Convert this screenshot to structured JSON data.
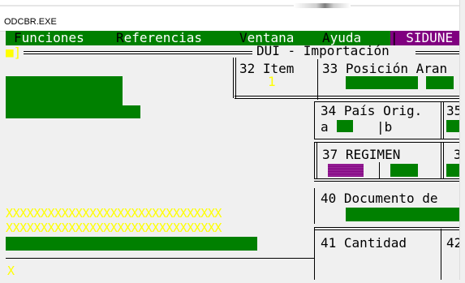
{
  "window": {
    "title": "ODCBR.EXE"
  },
  "menu": {
    "items": [
      {
        "hotkey": "F",
        "rest": "unciones"
      },
      {
        "hotkey": "R",
        "rest": "eferencias"
      },
      {
        "hotkey": "V",
        "rest": "entana"
      },
      {
        "hotkey": "A",
        "rest": "yuda"
      }
    ],
    "app_label": "SIDUNE"
  },
  "form": {
    "corner_marker": "■]",
    "title": "DUI - Importación",
    "fields": {
      "item_label": "32 Item",
      "item_value": "1",
      "posicion_label": "33 Posición Aran",
      "pais_label": "34 País Orig.",
      "pais_a": "a",
      "pais_b": "|b",
      "col35": "35",
      "regimen_label": "37 REGIMEN",
      "col3": "3",
      "documento_label": "40 Documento de",
      "cantidad_label": "41 Cantidad",
      "col42": "42"
    },
    "x_rows": [
      "XXXXXXXXXXXXXXXXXXXXXXXXXXXXXXX",
      "XXXXXXXXXXXXXXXXXXXXXXXXXXXXXXX"
    ],
    "cursor": "X"
  },
  "colors": {
    "console_bg": "#f0f0f0",
    "field_green": "#008000",
    "field_purple": "#800080",
    "highlight_yellow": "#ffff00"
  }
}
